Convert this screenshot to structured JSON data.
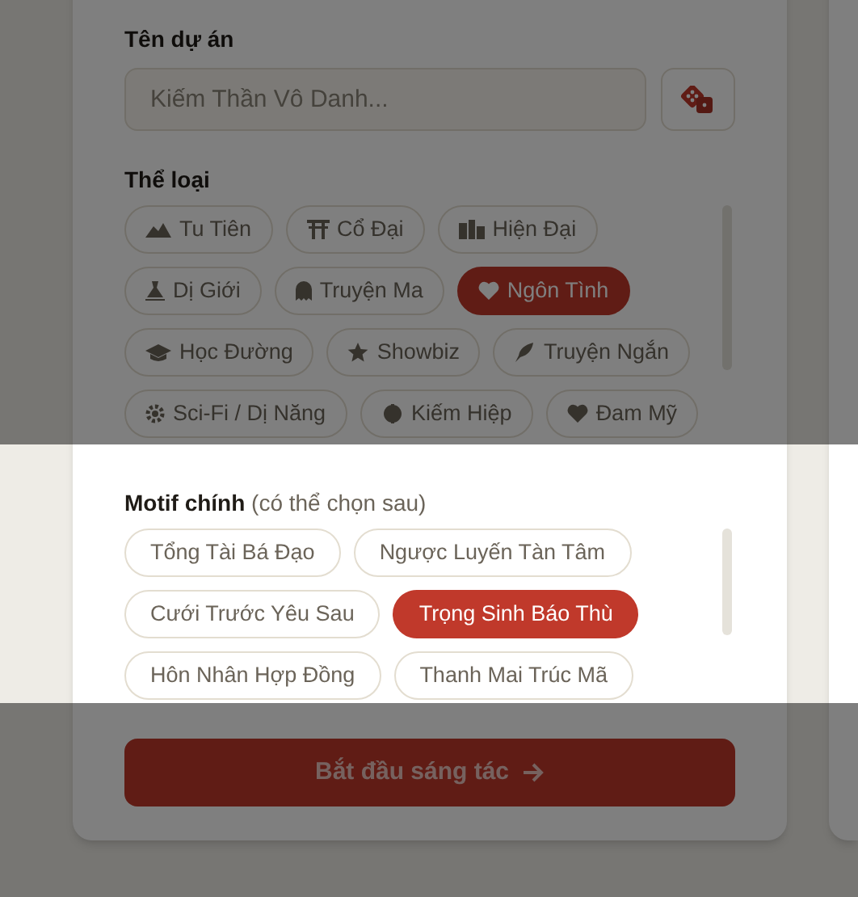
{
  "project_name": {
    "label": "Tên dự án",
    "placeholder": "Kiếm Thần Vô Danh..."
  },
  "genres": {
    "label": "Thể loại",
    "items": [
      {
        "label": "Tu Tiên",
        "selected": false
      },
      {
        "label": "Cổ Đại",
        "selected": false
      },
      {
        "label": "Hiện Đại",
        "selected": false
      },
      {
        "label": "Dị Giới",
        "selected": false
      },
      {
        "label": "Truyện Ma",
        "selected": false
      },
      {
        "label": "Ngôn Tình",
        "selected": true
      },
      {
        "label": "Học Đường",
        "selected": false
      },
      {
        "label": "Showbiz",
        "selected": false
      },
      {
        "label": "Truyện Ngắn",
        "selected": false
      },
      {
        "label": "Sci-Fi / Dị Năng",
        "selected": false
      },
      {
        "label": "Kiếm Hiệp",
        "selected": false
      },
      {
        "label": "Đam Mỹ",
        "selected": false
      }
    ]
  },
  "motifs": {
    "label": "**Motif chính** (có thể chọn sau)",
    "items": [
      {
        "label": "Tổng Tài Bá Đạo",
        "selected": false
      },
      {
        "label": "Ngược Luyến Tàn Tâm",
        "selected": false
      },
      {
        "label": "Cưới Trước Yêu Sau",
        "selected": false
      },
      {
        "label": "Trọng Sinh Báo Thù",
        "selected": true
      },
      {
        "label": "Hôn Nhân Hợp Đồng",
        "selected": false
      },
      {
        "label": "Thanh Mai Trúc Mã",
        "selected": false
      }
    ]
  },
  "start_button": {
    "label": "Bắt đầu sáng tác"
  }
}
